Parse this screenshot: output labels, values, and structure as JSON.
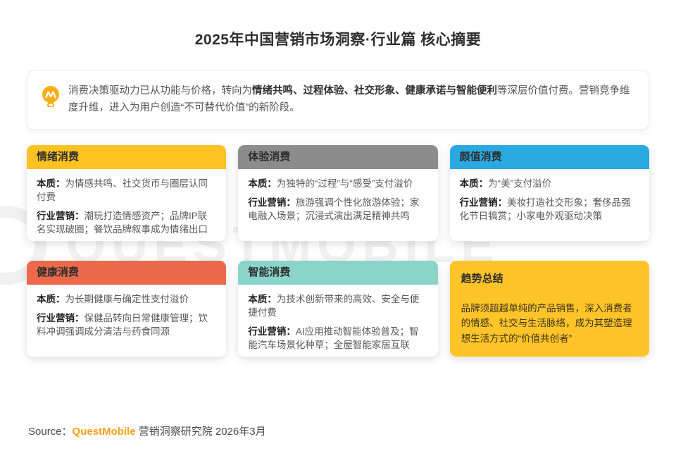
{
  "page": {
    "title": "2025年中国营销市场洞察·行业篇 核心摘要",
    "watermark": "QUESTMOBILE"
  },
  "intro": {
    "icon": "lightbulb-icon",
    "text_before": "消费决策驱动力已从功能与价格，转向为",
    "text_bold": "情绪共鸣、过程体验、社交形象、健康承诺与智能便利",
    "text_after": "等深层价值付费。营销竞争维度升维，进入为用户创造“不可替代价值”的新阶段。"
  },
  "labels": {
    "essence": "本质：",
    "marketing": "行业营销："
  },
  "cards": [
    {
      "title": "情绪消费",
      "header_color": "#FFC222",
      "essence": "为情感共鸣、社交货币与圈层认同付费",
      "marketing": "潮玩打造情感资产；品牌IP联名实现破圈；餐饮品牌叙事成为情绪出口"
    },
    {
      "title": "体验消费",
      "header_color": "#8C8C8C",
      "essence": "为独特的“过程”与“感受”支付溢价",
      "marketing": "旅游强调个性化旅游体验；家电融入场景；沉浸式演出满足精神共鸣"
    },
    {
      "title": "颜值消费",
      "header_color": "#29A9E0",
      "essence": "为“美”支付溢价",
      "marketing": "美妆打造社交形象；奢侈品强化节日犒赏；小家电外观驱动决策"
    },
    {
      "title": "健康消费",
      "header_color": "#EC6A4B",
      "essence": "为长期健康与确定性支付溢价",
      "marketing": "保健品转向日常健康管理；饮料冲调强调成分清洁与药食同源"
    },
    {
      "title": "智能消费",
      "header_color": "#8AD4CA",
      "essence": "为技术创新带来的高效、安全与便捷付费",
      "marketing": "AI应用推动智能体验普及；智能汽车场景化种草；全屋智能家居互联"
    }
  ],
  "trend": {
    "title": "趋势总结",
    "bg_color": "#FFC428",
    "body": "品牌须超越单纯的产品销售，深入消费者的情感、社交与生活脉络，成为其塑造理想生活方式的“价值共创者”"
  },
  "source": {
    "label": "Source：",
    "brand": "QuestMobile",
    "brand_color": "#F7A11A",
    "rest": " 营销洞察研究院 2026年3月"
  }
}
